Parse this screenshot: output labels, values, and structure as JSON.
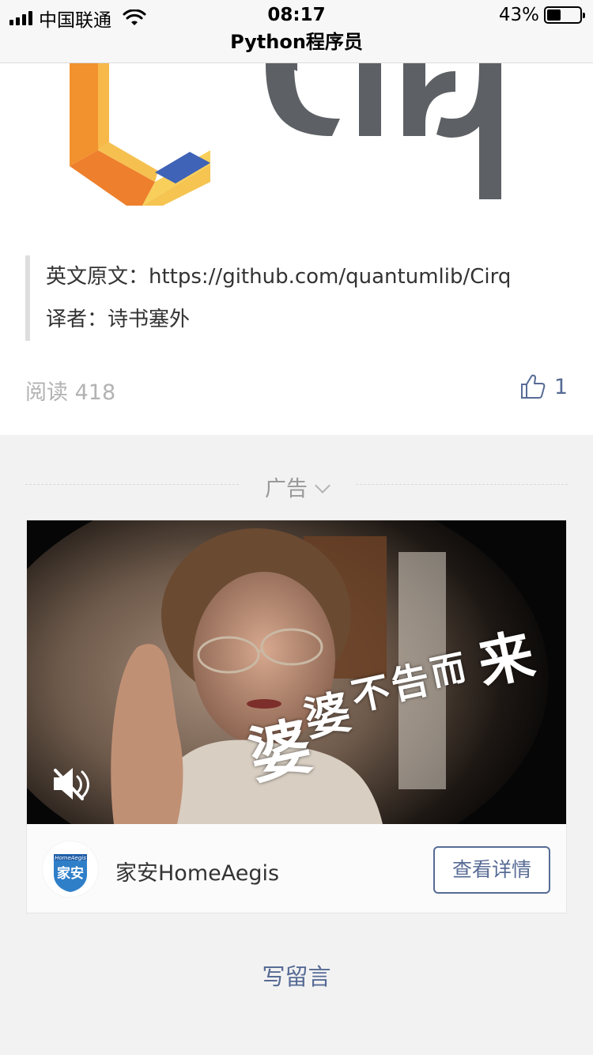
{
  "status_bar": {
    "carrier": "中国联通",
    "time": "08:17",
    "battery_text": "43%",
    "battery_level": 0.43
  },
  "nav": {
    "title": "Python程序员"
  },
  "article": {
    "logo_text": "Cirq",
    "source_line": "英文原文：https://github.com/quantumlib/Cirq",
    "translator_line": "译者：诗书塞外",
    "read_label": "阅读 418",
    "like_count": "1"
  },
  "ad": {
    "label": "广告",
    "video_text": [
      "婆",
      "婆",
      "不",
      "告",
      "而",
      "来"
    ],
    "brand_name": "家安HomeAegis",
    "brand_logo_text": "家安",
    "brand_logo_small": "HomeAegis",
    "detail_button": "查看详情"
  },
  "footer": {
    "write_comment": "写留言"
  },
  "colors": {
    "link": "#576b95",
    "gray_bg": "#f2f2f2"
  }
}
